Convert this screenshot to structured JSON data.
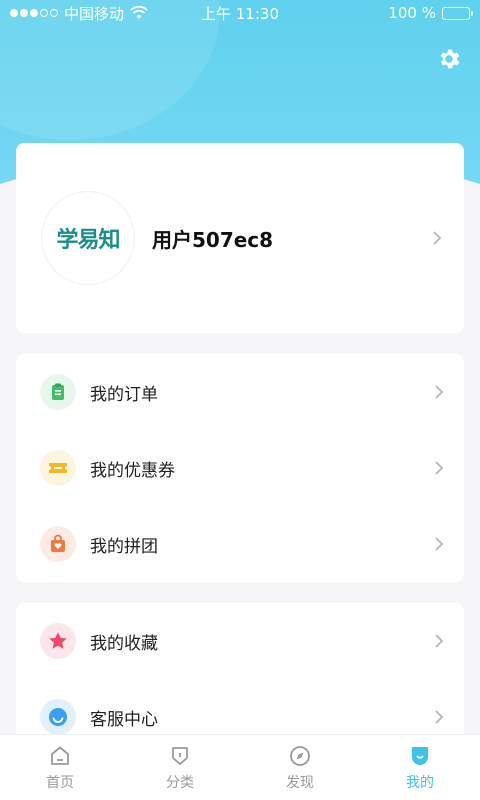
{
  "status_bar": {
    "carrier": "中国移动",
    "time": "上午 11:30",
    "battery": "100 %"
  },
  "profile": {
    "avatar_text": "学易知",
    "username": "用户507ec8"
  },
  "menu_group_1": [
    {
      "label": "我的订单",
      "icon": "order-icon",
      "color": "#3fbf6a"
    },
    {
      "label": "我的优惠券",
      "icon": "coupon-icon",
      "color": "#f5b824"
    },
    {
      "label": "我的拼团",
      "icon": "group-buy-icon",
      "color": "#f07a3c"
    }
  ],
  "menu_group_2": [
    {
      "label": "我的收藏",
      "icon": "star-icon",
      "color": "#f0476a"
    },
    {
      "label": "客服中心",
      "icon": "customer-service-icon",
      "color": "#3b9ef0"
    }
  ],
  "tabbar": [
    {
      "label": "首页",
      "icon": "home-icon",
      "active": false
    },
    {
      "label": "分类",
      "icon": "category-icon",
      "active": false
    },
    {
      "label": "发现",
      "icon": "compass-icon",
      "active": false
    },
    {
      "label": "我的",
      "icon": "profile-icon",
      "active": true
    }
  ],
  "colors": {
    "primary": "#3cc3e6",
    "header_gradient_top": "#5fd1ee",
    "header_gradient_bottom": "#83dcf5",
    "background": "#f6f6f8"
  }
}
